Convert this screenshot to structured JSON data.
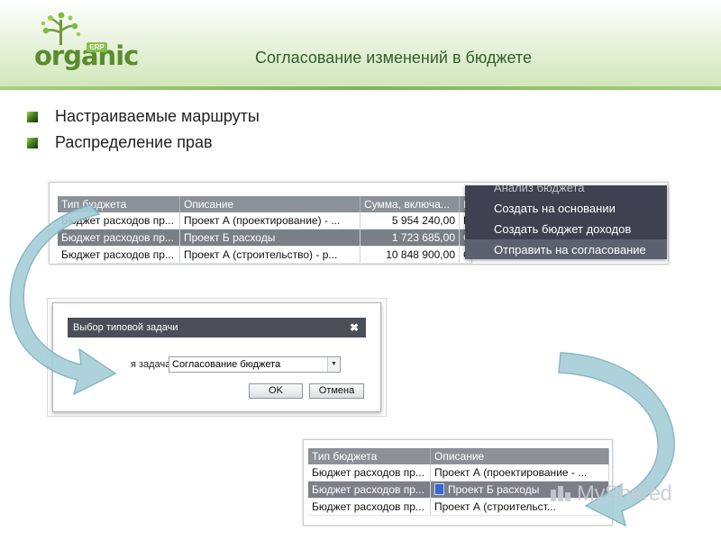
{
  "logo": {
    "text": "organic",
    "badge": "ERP"
  },
  "slide_title": "Согласование изменений в бюджете",
  "bullets": [
    "Настраиваемые маршруты",
    "Распределение прав"
  ],
  "grid1": {
    "headers": [
      "Тип бюджета",
      "Описание",
      "Сумма, включа...",
      "L"
    ],
    "rows": [
      [
        "Бюджет расходов пр...",
        "Проект А (проектирование) - ...",
        "5 954 240,00",
        "П"
      ],
      [
        "Бюджет расходов пр...",
        "Проект Б расходы",
        "1 723 685,00",
        "С"
      ],
      [
        "Бюджет расходов пр...",
        "Проект А (строительство) - р...",
        "10 848 900,00",
        "С"
      ]
    ],
    "selected_row": 1
  },
  "context_menu": {
    "items": [
      "Анализ бюджета",
      "Создать на основании",
      "Создать бюджет доходов",
      "Отправить на согласование"
    ],
    "highlighted": 3
  },
  "dialog": {
    "title": "Выбор типовой задачи",
    "close_glyph": "✖",
    "field_label": "я задача",
    "field_value": "Согласование бюджета",
    "ok_label": "OK",
    "cancel_label": "Отмена"
  },
  "grid2": {
    "headers": [
      "Тип бюджета",
      "Описание"
    ],
    "rows": [
      [
        "Бюджет расходов пр...",
        "Проект А (проектирование - ..."
      ],
      [
        "Бюджет расходов пр...",
        "Проект Б расходы"
      ],
      [
        "Бюджет расходов пр...",
        "Проект А (строительст..."
      ]
    ],
    "selected_row": 1
  },
  "watermark": "MyShared",
  "colors": {
    "accent_green": "#5a8c2b",
    "title_green": "#2f5f2a",
    "menu_bg": "#3e4250",
    "header_bg": "#8b9099",
    "arrow_fill": "#a7cfd8"
  },
  "icons": {
    "bullet": "green-square-icon",
    "close": "close-icon",
    "dropdown": "chevron-down-icon",
    "document": "document-icon"
  }
}
